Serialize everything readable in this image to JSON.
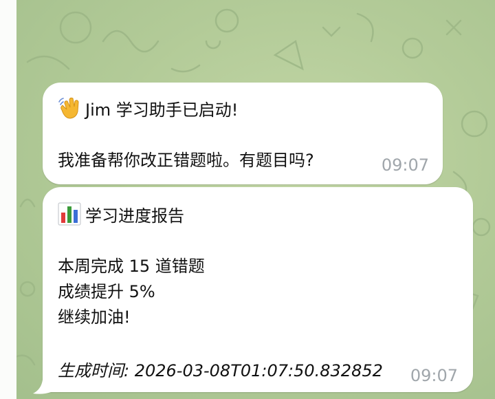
{
  "messages": [
    {
      "emoji": "waving-hand-icon",
      "title": "Jim 学习助手已启动!",
      "body": "我准备帮你改正错题啦。有题目吗?",
      "time": "09:07"
    },
    {
      "emoji": "bar-chart-icon",
      "title": "学习进度报告",
      "lines": [
        "本周完成 15 道错题",
        "成绩提升 5%",
        "继续加油!"
      ],
      "footer": "生成时间: 2026-03-08T01:07:50.832852",
      "time": "09:07"
    }
  ],
  "colors": {
    "wallpaper": "#a9c394",
    "bubble": "#ffffff",
    "timestamp": "#a0a6ab"
  }
}
